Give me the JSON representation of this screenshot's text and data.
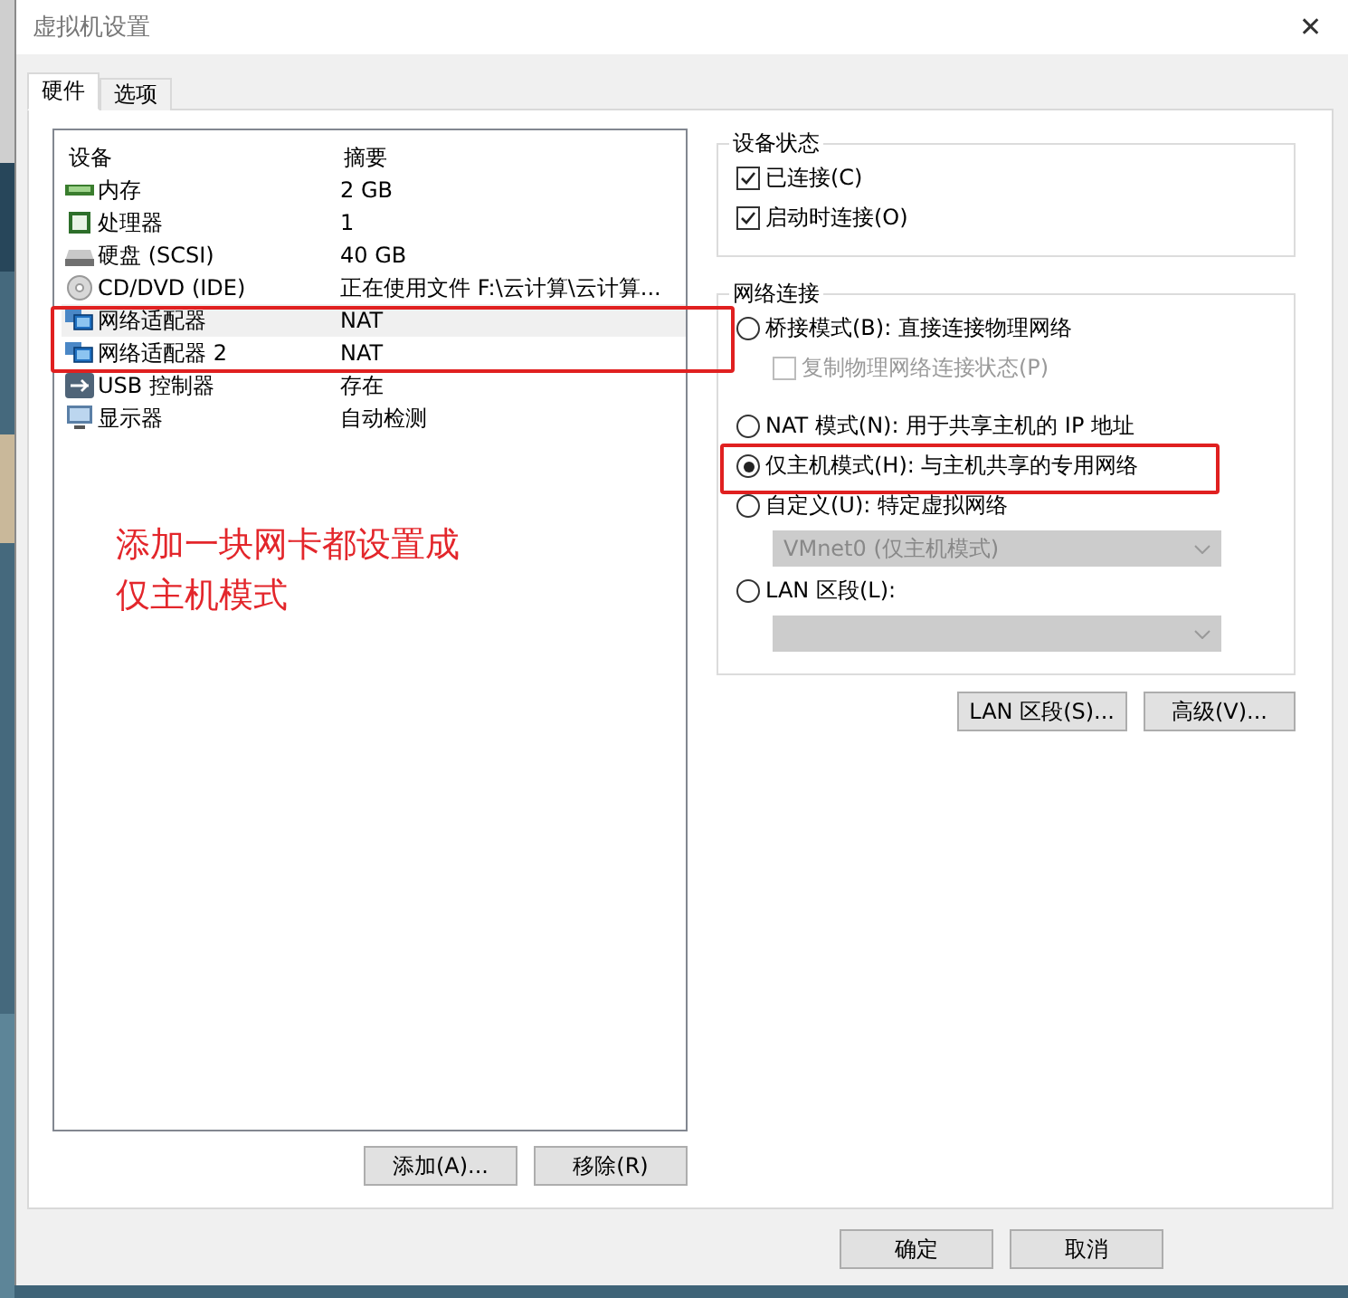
{
  "window": {
    "title": "虚拟机设置",
    "close": "✕"
  },
  "tabs": [
    {
      "label": "硬件",
      "selected": true
    },
    {
      "label": "选项",
      "selected": false
    }
  ],
  "device_table": {
    "columns": [
      "设备",
      "摘要"
    ],
    "rows": [
      {
        "kind": "memory",
        "device": "内存",
        "summary": "2 GB",
        "selected": false
      },
      {
        "kind": "cpu",
        "device": "处理器",
        "summary": "1",
        "selected": false
      },
      {
        "kind": "disk",
        "device": "硬盘 (SCSI)",
        "summary": "40 GB",
        "selected": false
      },
      {
        "kind": "cdrom",
        "device": "CD/DVD (IDE)",
        "summary": "正在使用文件 F:\\云计算\\云计算...",
        "selected": false
      },
      {
        "kind": "network",
        "device": "网络适配器",
        "summary": "NAT",
        "selected": true
      },
      {
        "kind": "network",
        "device": "网络适配器 2",
        "summary": "NAT",
        "selected": false
      },
      {
        "kind": "usb",
        "device": "USB 控制器",
        "summary": "存在",
        "selected": false
      },
      {
        "kind": "display",
        "device": "显示器",
        "summary": "自动检测",
        "selected": false
      }
    ]
  },
  "annotation_note": [
    "添加一块网卡都设置成",
    "仅主机模式"
  ],
  "list_buttons": [
    "添加(A)...",
    "移除(R)"
  ],
  "device_status": {
    "title": "设备状态",
    "options": [
      {
        "label": "已连接(C)",
        "checked": true
      },
      {
        "label": "启动时连接(O)",
        "checked": true
      }
    ]
  },
  "network_connection": {
    "title": "网络连接",
    "options": [
      {
        "kind": "radio",
        "label": "桥接模式(B): 直接连接物理网络",
        "selected": false
      },
      {
        "kind": "checkbox",
        "label": "复制物理网络连接状态(P)",
        "checked": false,
        "disabled": true
      },
      {
        "kind": "radio",
        "label": "NAT 模式(N): 用于共享主机的 IP 地址",
        "selected": false
      },
      {
        "kind": "radio",
        "label": "仅主机模式(H): 与主机共享的专用网络",
        "selected": true
      },
      {
        "kind": "radio",
        "label": "自定义(U): 特定虚拟网络",
        "selected": false
      },
      {
        "kind": "select",
        "value": "VMnet0 (仅主机模式)",
        "disabled": true
      },
      {
        "kind": "radio",
        "label": "LAN 区段(L):",
        "selected": false
      },
      {
        "kind": "select",
        "disabled": true
      }
    ]
  },
  "network_buttons": [
    "LAN 区段(S)...",
    "高级(V)..."
  ],
  "dialog_buttons": [
    "确定",
    "取消"
  ]
}
